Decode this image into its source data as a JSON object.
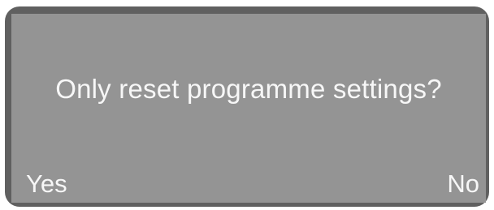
{
  "display": {
    "message": "Only reset programme settings?",
    "left_option": "Yes",
    "right_option": "No"
  },
  "colors": {
    "bezel": "#606060",
    "screen": "#949494",
    "text": "#f7f7f7"
  }
}
